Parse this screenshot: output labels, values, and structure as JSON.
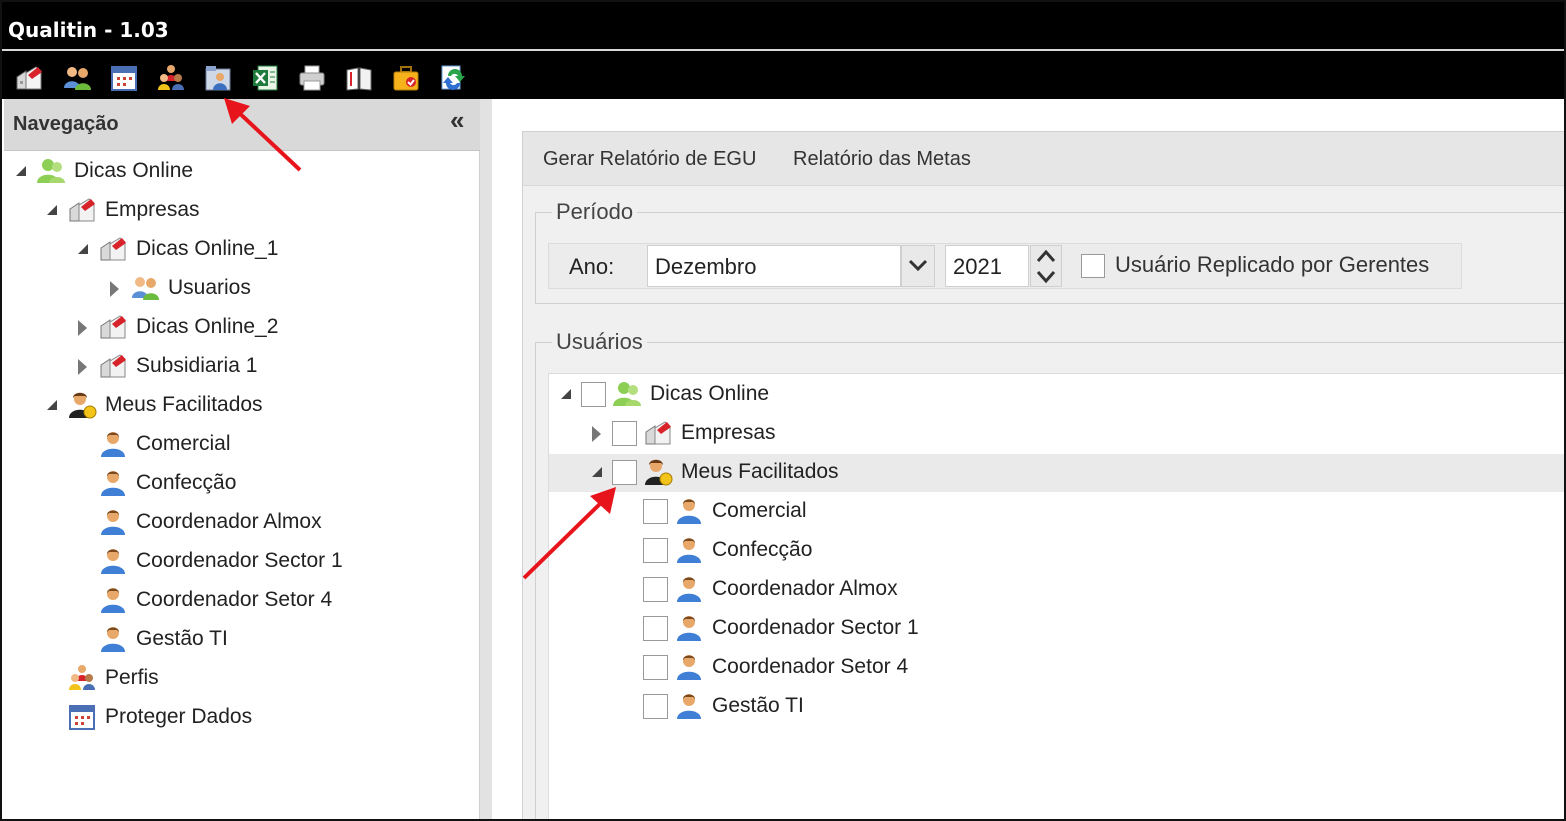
{
  "window": {
    "title": "Qualitin - 1.03"
  },
  "toolbar": {
    "icons": [
      "companies-icon",
      "users-icon",
      "calendar-icon",
      "profiles-icon",
      "user-report-icon",
      "excel-icon",
      "printer-icon",
      "book-icon",
      "briefcase-icon",
      "refresh-icon"
    ]
  },
  "nav": {
    "title": "Navegação",
    "collapse_glyph": "«",
    "tree": {
      "root": "Dicas Online",
      "empresas": "Empresas",
      "dicas1": "Dicas Online_1",
      "usuarios": "Usuarios",
      "dicas2": "Dicas Online_2",
      "subsidiaria": "Subsidiaria 1",
      "facilitados": "Meus Facilitados",
      "users": [
        "Comercial",
        "Confecção",
        "Coordenador Almox",
        "Coordenador Sector 1",
        "Coordenador Setor 4",
        "Gestão TI"
      ],
      "perfis": "Perfis",
      "proteger": "Proteger Dados"
    }
  },
  "main": {
    "tabs": [
      "Gerar Relatório de EGU",
      "Relatório das Metas"
    ],
    "periodo": {
      "legend": "Período",
      "ano_label": "Ano:",
      "month_value": "Dezembro",
      "year_value": "2021",
      "replicado_label": "Usuário Replicado por Gerentes",
      "replicado_checked": false
    },
    "usuarios": {
      "legend": "Usuários",
      "root": "Dicas Online",
      "empresas": "Empresas",
      "facilitados": "Meus Facilitados",
      "users": [
        "Comercial",
        "Confecção",
        "Coordenador Almox",
        "Coordenador Sector 1",
        "Coordenador Setor 4",
        "Gestão TI"
      ]
    }
  },
  "colors": {
    "titlebar": "#000000",
    "annotation_arrow": "#e8141c",
    "panel": "#f0f0f0"
  }
}
